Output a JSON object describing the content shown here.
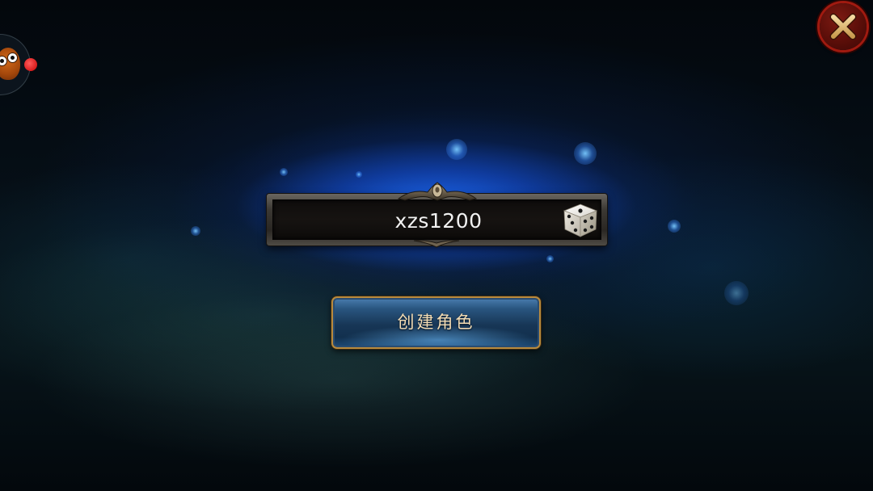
{
  "screen": "create-character",
  "name_field": {
    "value": "xzs1200"
  },
  "create_button": {
    "label": "创建角色"
  },
  "icons": {
    "close": "close-x-icon",
    "random_name": "dice-icon",
    "floating_menu": "monster-avatar-icon"
  },
  "colors": {
    "close_button": "#8a1a12",
    "button_border": "#b88a3e",
    "button_text": "#f3dcb4",
    "glow": "#1e6eff"
  }
}
